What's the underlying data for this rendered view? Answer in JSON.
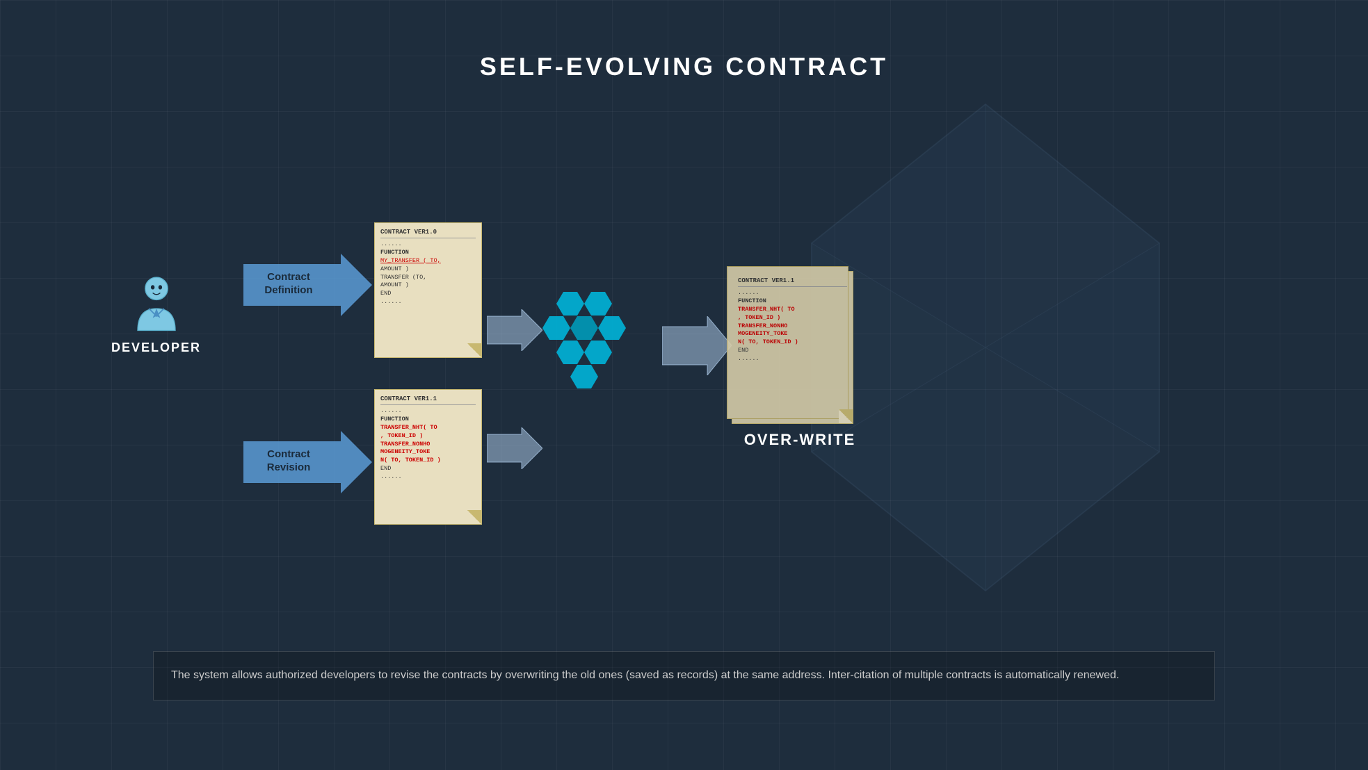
{
  "title": "SELF-EVOLVING CONTRACT",
  "developer_label": "DEVELOPER",
  "arrow_definition_label": "Contract\nDefinition",
  "arrow_revision_label": "Contract\nRevision",
  "overwrite_label": "OVER-WRITE",
  "description": "The system allows authorized developers to revise the contracts by overwriting the old ones (saved as records) at the same address. Inter-citation of multiple contracts is automatically renewed.",
  "contract_v1": {
    "title": "CONTRACT VER1.0",
    "line1": "......",
    "line2": "FUNCTION",
    "line3": "MY_TRANSFER ( TO,",
    "line4": "AMOUNT )",
    "line5": "TRANSFER (TO,",
    "line6": "AMOUNT )",
    "line7": "END",
    "line8": "......"
  },
  "contract_v11": {
    "title": "CONTRACT VER1.1",
    "line1": "......",
    "line2": "FUNCTION",
    "line3": "TRANSFER_NHT( TO",
    "line4": ", TOKEN_ID )",
    "line5": "TRANSFER_NONHO",
    "line6": "MOGENEITY_TOKE",
    "line7": "N( TO, TOKEN_ID )",
    "line8": "END",
    "line9": "......"
  },
  "contract_v11b": {
    "title": "CONTRACT VER1.1",
    "line1": "......",
    "line2": "FUNCTION",
    "line3": "TRANSFER_NHT( TO",
    "line4": ", TOKEN_ID )",
    "line5": "TRANSFER_NONHO",
    "line6": "MOGENEITY_TOKE",
    "line7": "N( TO, TOKEN_ID )",
    "line8": "END",
    "line9": "......"
  },
  "colors": {
    "arrow_blue": "#5b9bd5",
    "doc_bg": "#e8dfc0",
    "doc_border": "#c8b870",
    "hex_cyan": "#00b4d8",
    "title_white": "#ffffff"
  }
}
